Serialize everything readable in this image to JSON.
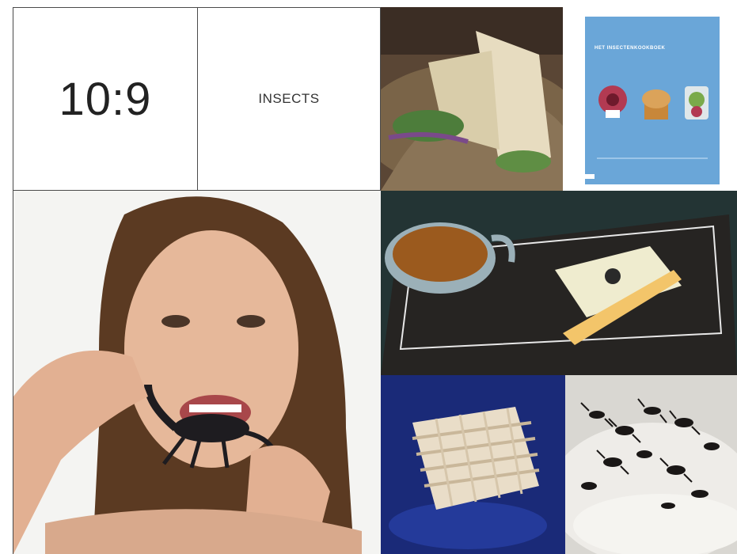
{
  "tiles": {
    "clock": {
      "text": "10:9"
    },
    "category": {
      "text": "INSECTS"
    },
    "book": {
      "title": "HET INSECTENKOOKBOEK",
      "bg": "#6aa6d8"
    }
  },
  "images": {
    "wrap": "photo-insect-wrap",
    "book_cover": "book-cover",
    "woman_scorpion": "photo-woman-eating-scorpion",
    "creme_brulee": "photo-creme-brulee-dessert",
    "larvae_block": "photo-larvae-block",
    "ants_dish": "photo-ants-on-puree"
  }
}
